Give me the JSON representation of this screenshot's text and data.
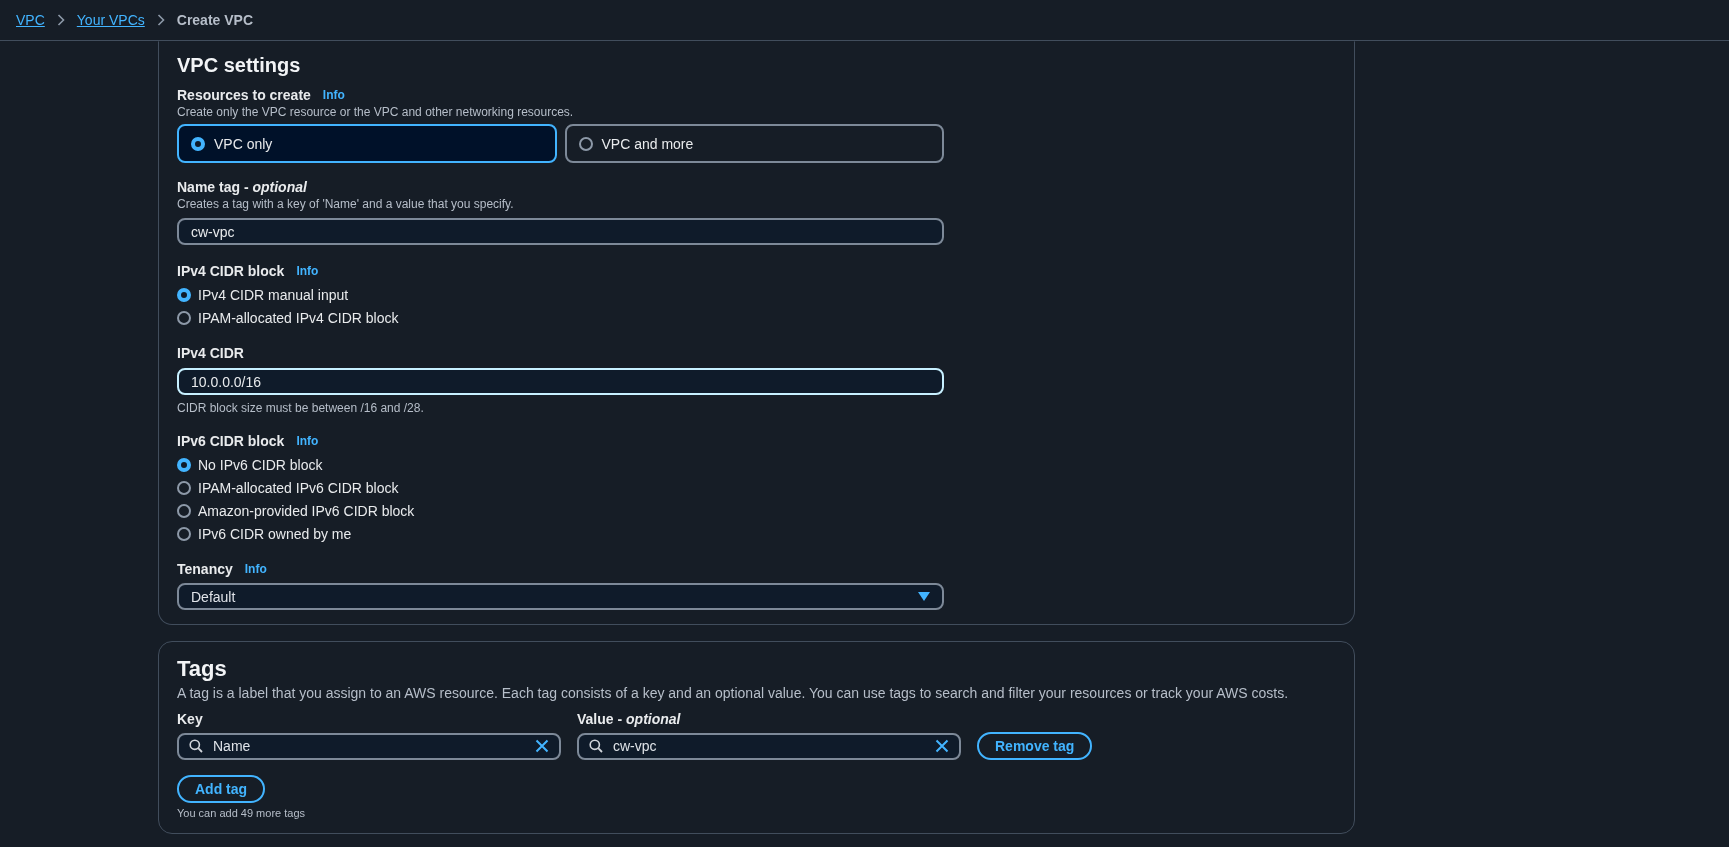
{
  "breadcrumb": [
    {
      "label": "VPC",
      "kind": "link"
    },
    {
      "label": "Your VPCs",
      "kind": "link"
    },
    {
      "label": "Create VPC",
      "kind": "current"
    }
  ],
  "vpc_settings": {
    "title": "VPC settings",
    "resources": {
      "label": "Resources to create",
      "info": "Info",
      "description": "Create only the VPC resource or the VPC and other networking resources.",
      "options": [
        {
          "label": "VPC only",
          "selected": true
        },
        {
          "label": "VPC and more",
          "selected": false
        }
      ]
    },
    "name_tag": {
      "label": "Name tag - *optional*",
      "description": "Creates a tag with a key of 'Name' and a value that you specify.",
      "value": "cw-vpc"
    },
    "ipv4_block": {
      "label": "IPv4 CIDR block",
      "info": "Info",
      "options": [
        {
          "label": "IPv4 CIDR manual input",
          "selected": true
        },
        {
          "label": "IPAM-allocated IPv4 CIDR block",
          "selected": false
        }
      ]
    },
    "ipv4_cidr": {
      "label": "IPv4 CIDR",
      "value": "10.0.0.0/16",
      "focused": true,
      "hint": "CIDR block size must be between /16 and /28."
    },
    "ipv6_block": {
      "label": "IPv6 CIDR block",
      "info": "Info",
      "options": [
        {
          "label": "No IPv6 CIDR block",
          "selected": true
        },
        {
          "label": "IPAM-allocated IPv6 CIDR block",
          "selected": false
        },
        {
          "label": "Amazon-provided IPv6 CIDR block",
          "selected": false
        },
        {
          "label": "IPv6 CIDR owned by me",
          "selected": false
        }
      ]
    },
    "tenancy": {
      "label": "Tenancy",
      "info": "Info",
      "value": "Default"
    }
  },
  "tags": {
    "title": "Tags",
    "description": "A tag is a label that you assign to an AWS resource. Each tag consists of a key and an optional value. You can use tags to search and filter your resources or track your AWS costs.",
    "key_label": "Key",
    "value_label": "Value - *optional*",
    "rows": [
      {
        "key": "Name",
        "value": "cw-vpc",
        "remove": "Remove tag"
      }
    ],
    "add_button": "Add tag",
    "footer": "You can add 49 more tags"
  }
}
